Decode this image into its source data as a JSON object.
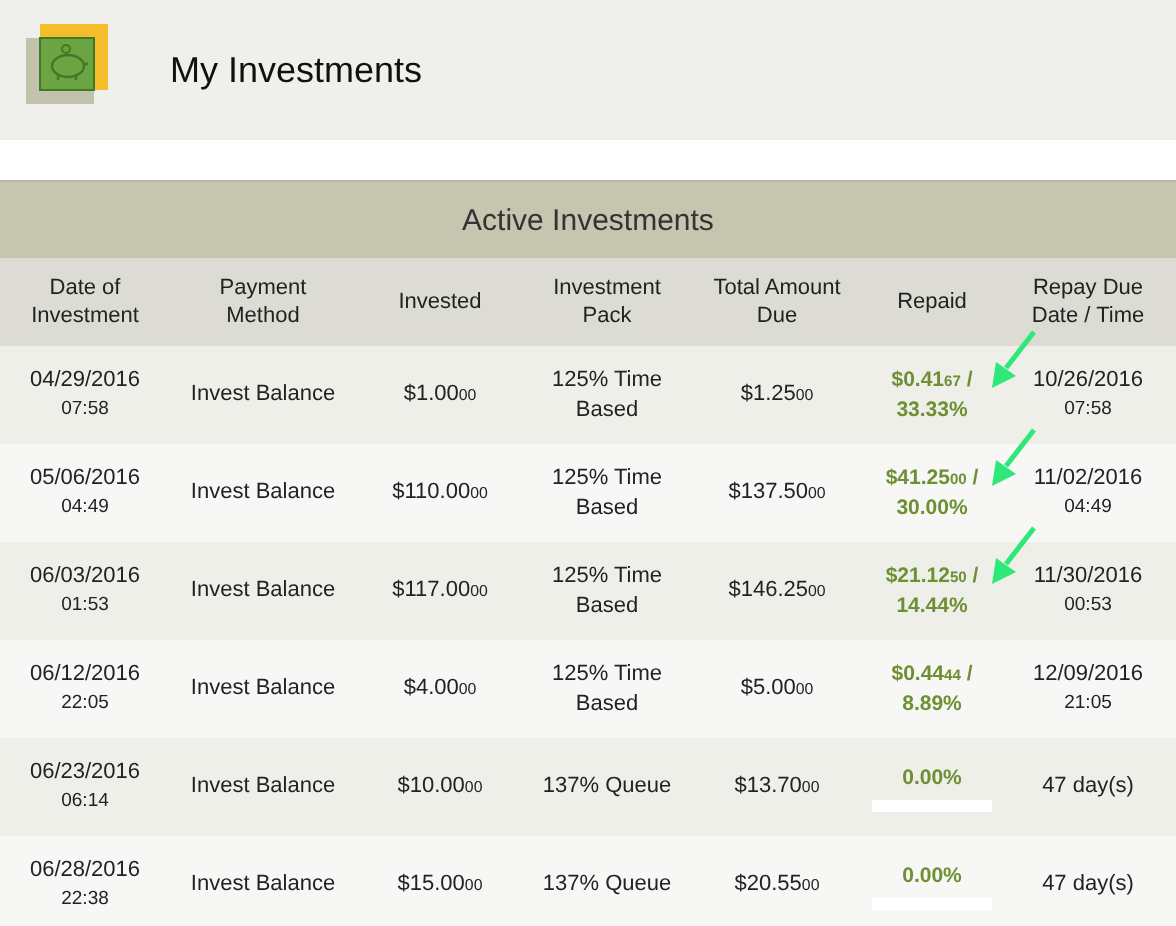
{
  "page": {
    "title": "My Investments"
  },
  "table": {
    "title": "Active Investments",
    "columns": [
      "Date of Investment",
      "Payment Method",
      "Invested",
      "Investment Pack",
      "Total Amount Due",
      "Repaid",
      "Repay Due Date / Time"
    ],
    "rows": [
      {
        "date": "04/29/2016",
        "time": "07:58",
        "method": "Invest Balance",
        "invested": "$1.00$_{00}$",
        "pack": "125% Time Based",
        "due": "$1.25$_{00}$",
        "kind": "amount",
        "repaid": "$0.41$_{67}$ /",
        "percent": "33.33%",
        "repay_date": "10/26/2016",
        "repay_time": "07:58",
        "annotated": true
      },
      {
        "date": "05/06/2016",
        "time": "04:49",
        "method": "Invest Balance",
        "invested": "$110.00$_{00}$",
        "pack": "125% Time Based",
        "due": "$137.50$_{00}$",
        "kind": "amount",
        "repaid": "$41.25$_{00}$ /",
        "percent": "30.00%",
        "repay_date": "11/02/2016",
        "repay_time": "04:49",
        "annotated": true
      },
      {
        "date": "06/03/2016",
        "time": "01:53",
        "method": "Invest Balance",
        "invested": "$117.00$_{00}$",
        "pack": "125% Time Based",
        "due": "$146.25$_{00}$",
        "kind": "amount",
        "repaid": "$21.12$_{50}$ /",
        "percent": "14.44%",
        "repay_date": "11/30/2016",
        "repay_time": "00:53",
        "annotated": true
      },
      {
        "date": "06/12/2016",
        "time": "22:05",
        "method": "Invest Balance",
        "invested": "$4.00$_{00}$",
        "pack": "125% Time Based",
        "due": "$5.00$_{00}$",
        "kind": "amount",
        "repaid": "$0.44$_{44}$ /",
        "percent": "8.89%",
        "repay_date": "12/09/2016",
        "repay_time": "21:05",
        "annotated": false
      },
      {
        "date": "06/23/2016",
        "time": "06:14",
        "method": "Invest Balance",
        "invested": "$10.00$_{00}$",
        "pack": "137% Queue",
        "due": "$13.70$_{00}$",
        "kind": "queue",
        "percent": "0.00%",
        "level": 0,
        "repay_days": "47 day(s)",
        "annotated": false
      },
      {
        "date": "06/28/2016",
        "time": "22:38",
        "method": "Invest Balance",
        "invested": "$15.00$_{00}$",
        "pack": "137% Queue",
        "due": "$20.55$_{00}$",
        "kind": "queue",
        "percent": "0.00%",
        "level": 0,
        "repay_days": "47 day(s)",
        "annotated": false
      }
    ]
  }
}
